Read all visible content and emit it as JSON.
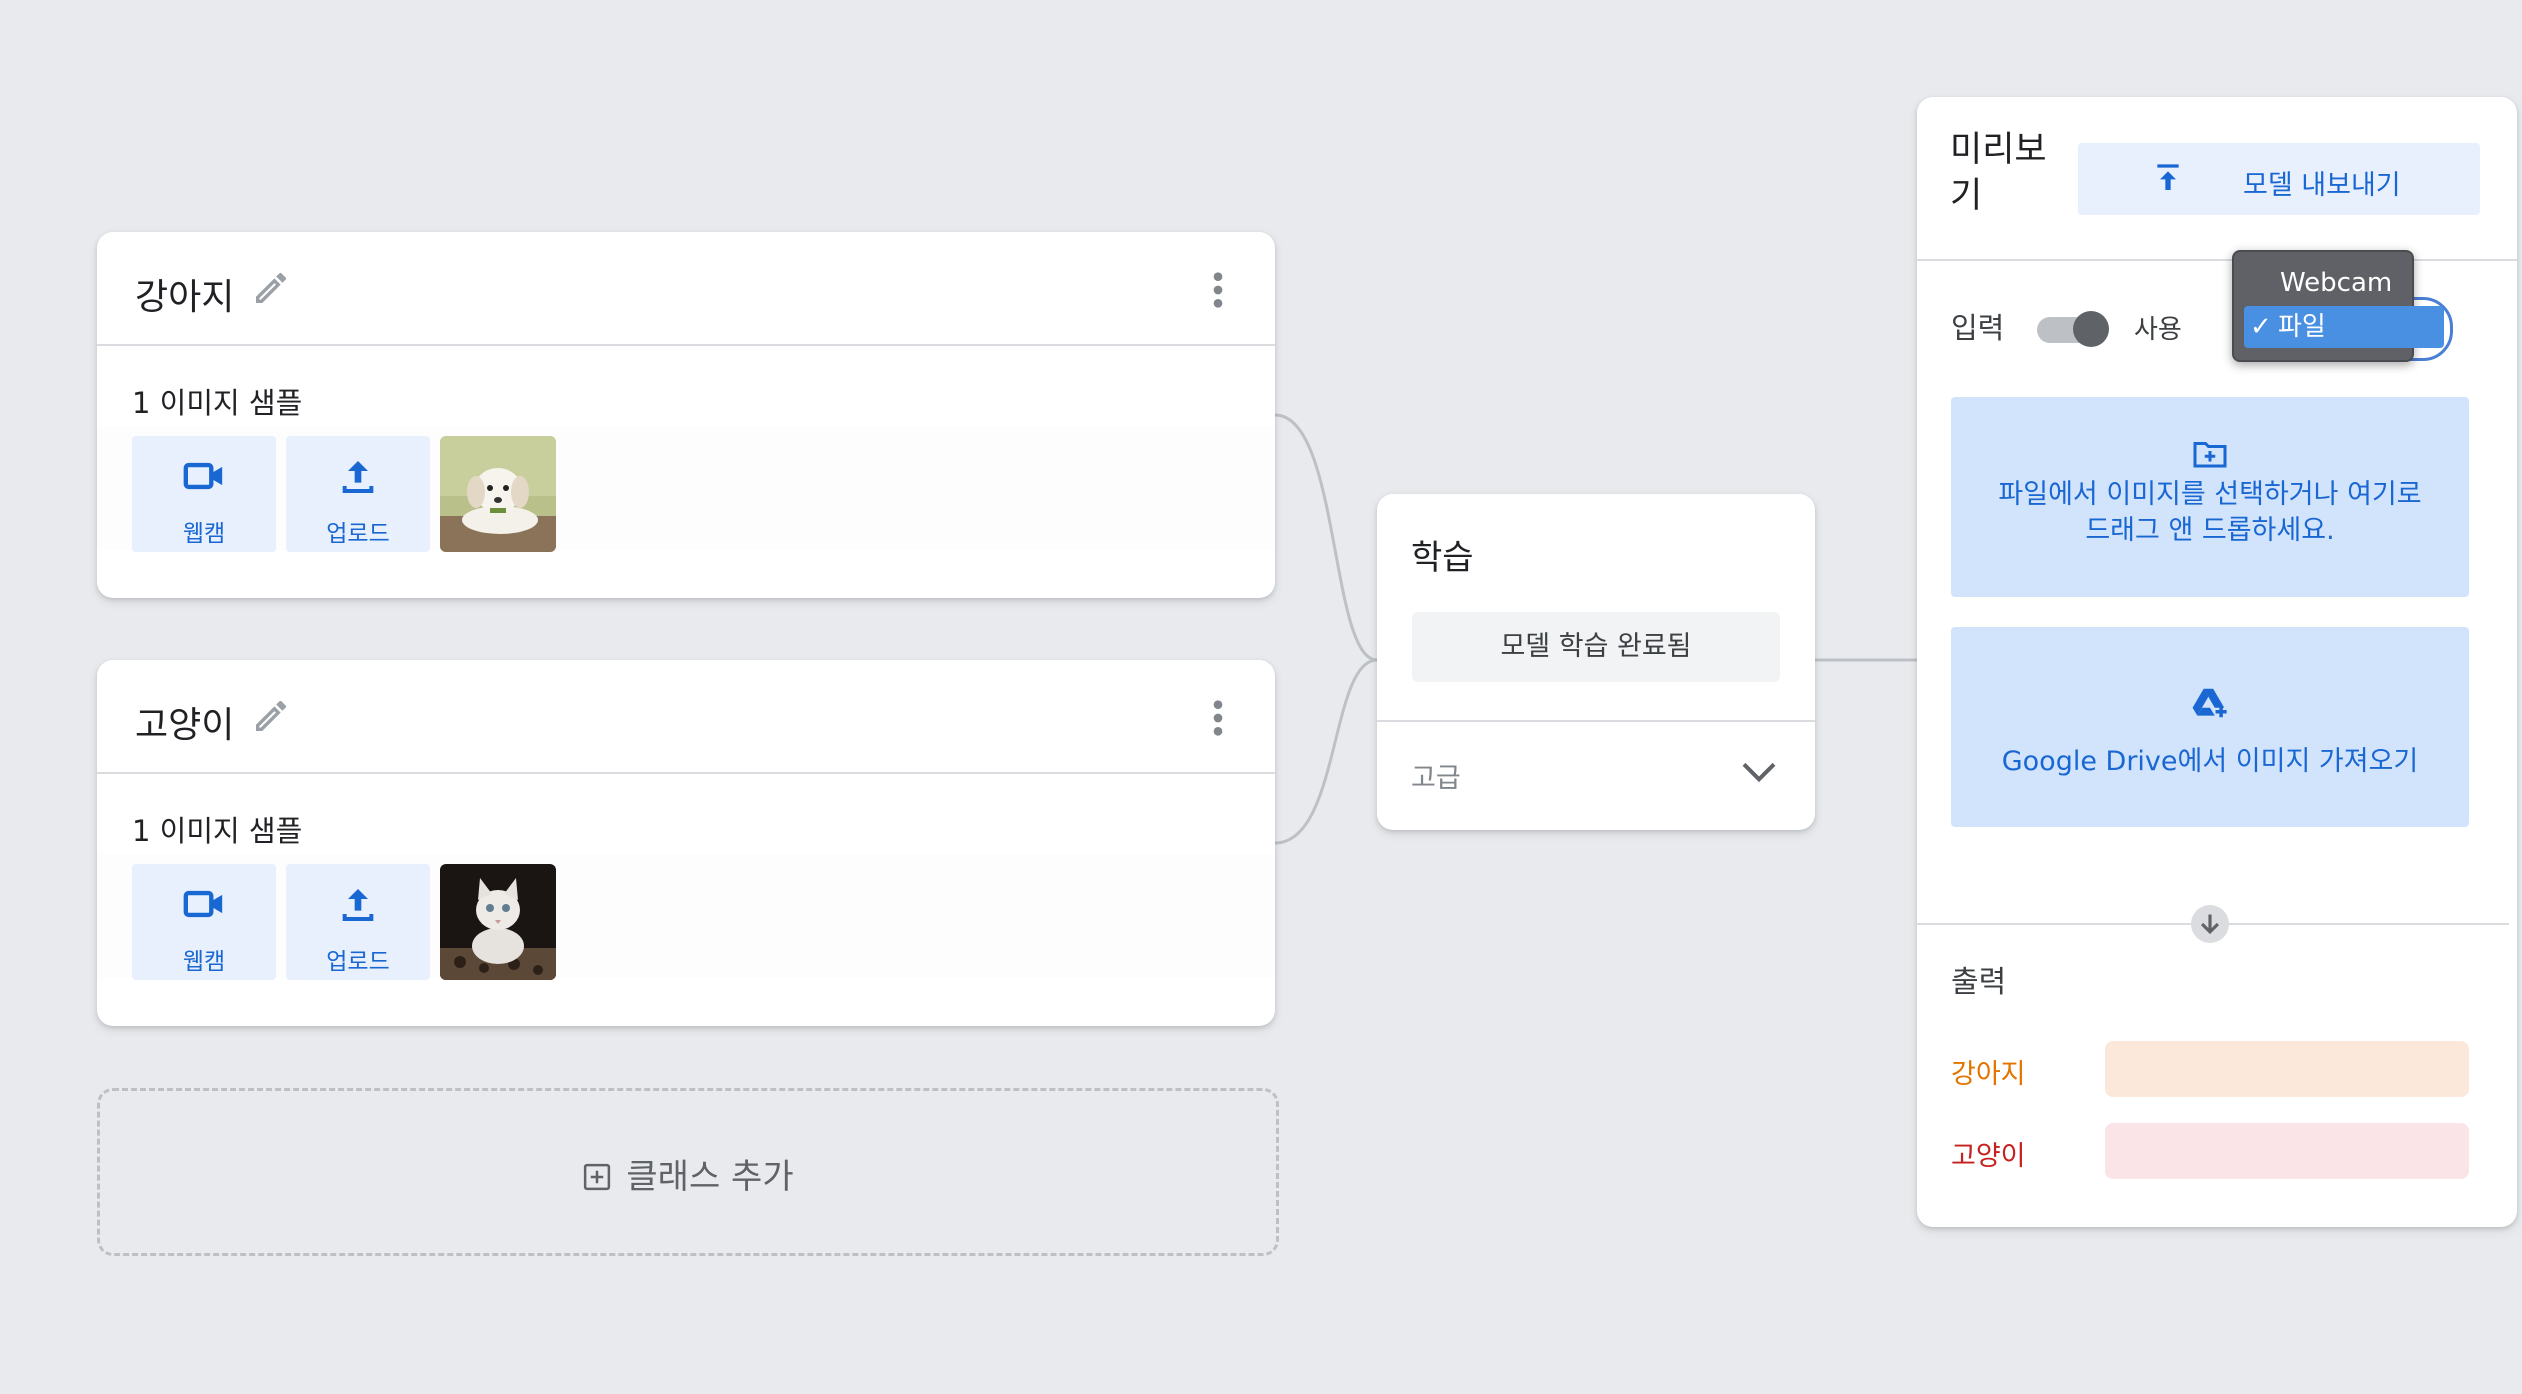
{
  "classes": [
    {
      "name": "강아지",
      "sample_count": "1 이미지 샘플",
      "webcam_label": "웹캠",
      "upload_label": "업로드"
    },
    {
      "name": "고양이",
      "sample_count": "1 이미지 샘플",
      "webcam_label": "웹캠",
      "upload_label": "업로드"
    }
  ],
  "add_class_label": "클래스 추가",
  "training": {
    "title": "학습",
    "status_button": "모델 학습 완료됨",
    "advanced_label": "고급"
  },
  "preview": {
    "title": "미리보기",
    "export_button": "모델 내보내기",
    "input_label": "입력",
    "toggle_label": "사용",
    "toggle_on": true,
    "dropzone_line1": "파일에서 이미지를 선택하거나 여기로",
    "dropzone_line2": "드래그 앤 드롭하세요.",
    "gdrive_label": "Google Drive에서 이미지 가져오기",
    "output_label": "출력",
    "outputs": [
      {
        "label": "강아지",
        "color": "#e37400",
        "bar_color": "#fce8db"
      },
      {
        "label": "고양이",
        "color": "#c5221f",
        "bar_color": "#fbe4e7"
      }
    ]
  },
  "input_source_dropdown": {
    "options": [
      "Webcam",
      "파일"
    ],
    "selected": "파일",
    "check_mark": "✓"
  },
  "colors": {
    "accent_blue": "#1967d2",
    "light_blue": "#e8f0fe",
    "dropzone_blue": "#d2e3fc",
    "background": "#e8eaed"
  }
}
